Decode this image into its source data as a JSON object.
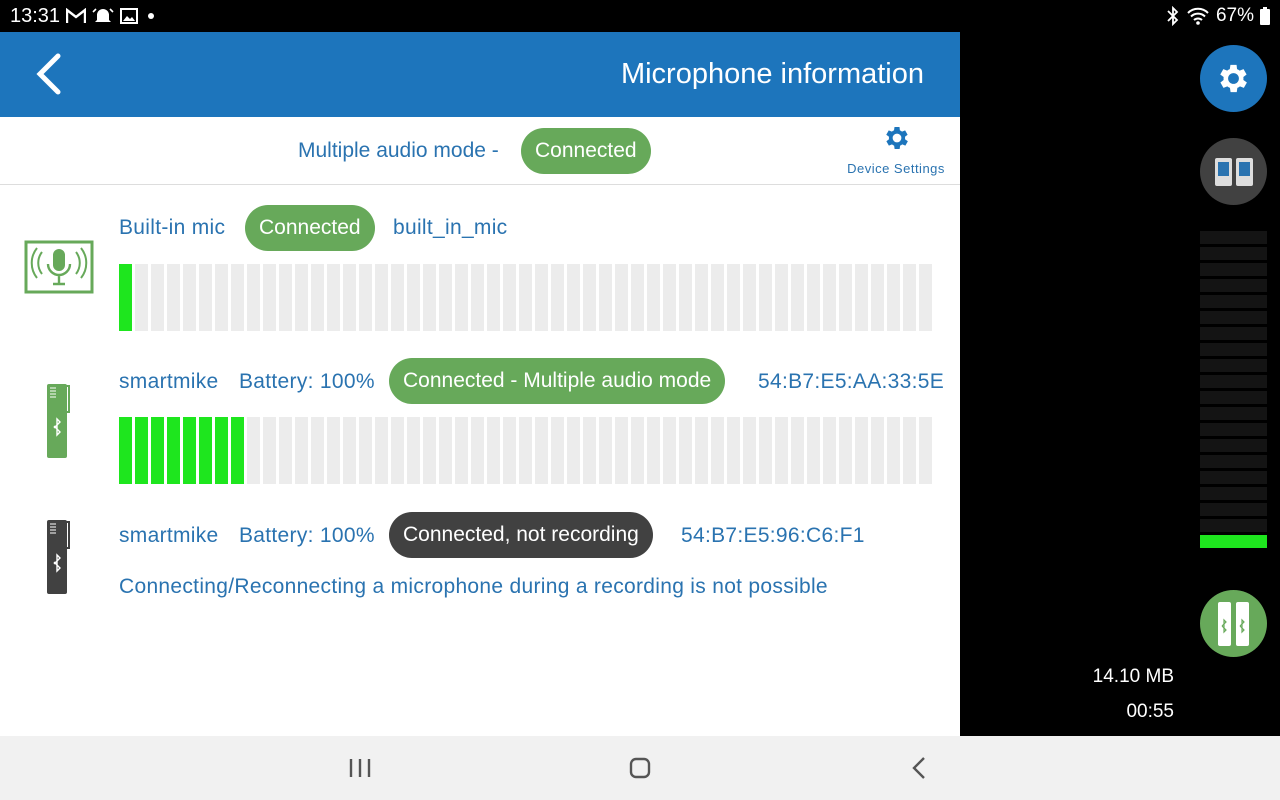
{
  "status_bar": {
    "time": "13:31",
    "battery": "67%",
    "icons_left": [
      "gmail-icon",
      "alarm-icon",
      "image-icon",
      "dot-icon"
    ],
    "icons_right": [
      "bluetooth-icon",
      "wifi-icon",
      "battery-icon"
    ]
  },
  "app_bar": {
    "title": "Microphone information"
  },
  "mode": {
    "text": "Multiple audio mode -",
    "status": "Connected",
    "settings_label": "Device Settings"
  },
  "devices": [
    {
      "name": "Built-in mic",
      "status": "Connected",
      "id": "built_in_mic",
      "meter_level_segments": 1,
      "status_color": "#67a95a"
    },
    {
      "name": "smartmike",
      "battery": "Battery: 100%",
      "status": "Connected - Multiple audio mode",
      "id": "54:B7:E5:AA:33:5E",
      "meter_level_segments": 8,
      "status_color": "#67a95a"
    },
    {
      "name": "smartmike",
      "battery": "Battery: 100%",
      "status": "Connected, not recording",
      "id": "54:B7:E5:96:C6:F1",
      "status_color": "#414141",
      "note": "Connecting/Reconnecting a microphone during a recording is not possible"
    }
  ],
  "meter": {
    "total_segments": 51
  },
  "side_panel": {
    "file_size": "14.10 MB",
    "duration": "00:55",
    "vertical_meter_segments": 20,
    "vertical_meter_level": 1
  },
  "colors": {
    "app_blue": "#1d75bc",
    "text_blue": "#2a73b0",
    "connected_green": "#67a95a",
    "meter_green": "#1ee61e"
  }
}
